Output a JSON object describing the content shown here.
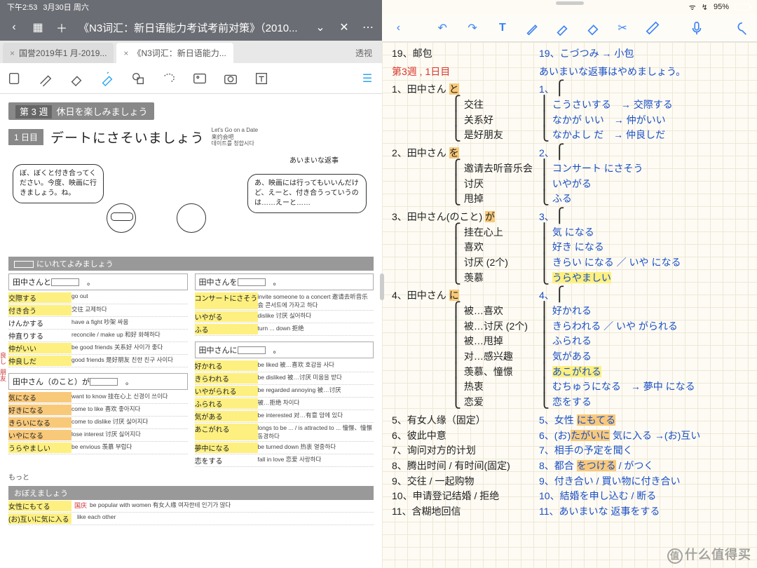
{
  "status": {
    "time": "下午2:53",
    "date": "3月30日 周六",
    "battery": "95%"
  },
  "left": {
    "header": {
      "title": "《N3词汇：新日语能力考试考前对策》（2010..."
    },
    "tabs": {
      "t1": "国誉2019年1 月-2019...",
      "t2": "《N3词汇：新日语能力...",
      "extra": "透视"
    },
    "week": {
      "num": "第 3 週",
      "title": "休日を楽しみましょう"
    },
    "day": {
      "badge": "1 日目",
      "title": "デートにさそいましょう",
      "sub1": "Let's Go on a Date",
      "sub2": "来约会吧",
      "sub3": "데이트를 청합시다"
    },
    "arrow_label": "あいまいな返事",
    "bubble1": "ぼ、ぼくと付き合ってください。今度、映画に行きましょう。ね。",
    "bubble2": "あ、映画には行ってもいいんだけど、えーと、付き合うっていうのは……えーと……",
    "section_reading": "にいれてよみましょう",
    "section_memo": "おぼえましょう",
    "motto": "もっと",
    "col1": {
      "header": "田中さんと",
      "rows": [
        {
          "jp": "交際する",
          "en": "go out",
          "hl": "y"
        },
        {
          "jp": "付き合う",
          "en": "交往  교제하다",
          "hl": "y"
        },
        {
          "jp": "けんかする",
          "en": "have a fight  吵架  싸움"
        },
        {
          "jp": "仲直りする",
          "en": "reconcile / make up\n和好  화해하다"
        },
        {
          "jp": "仲がいい",
          "en": "be good friends\n关系好  사이가 좋다",
          "hl": "y"
        },
        {
          "jp": "仲良しだ",
          "en": "good friends\n是好朋友  친한 친구 사이다",
          "hl": "y"
        }
      ]
    },
    "col2": {
      "header": "田中さんを",
      "rows": [
        {
          "jp": "コンサートにさそう",
          "en": "invite someone to a concert\n邀请去听音乐会\n콘서트에 가자고 하다",
          "hl": "y"
        },
        {
          "jp": "いやがる",
          "en": "dislike  讨厌  싫어하다",
          "hl": "y"
        },
        {
          "jp": "ふる",
          "en": "turn ... down  拒绝",
          "hl": "y"
        }
      ]
    },
    "col3": {
      "header": "田中さん（のこと）が",
      "rows": [
        {
          "jp": "気になる",
          "en": "want to know\n挂在心上  신경이 쓰이다",
          "hl": "o"
        },
        {
          "jp": "好きになる",
          "en": "come to like\n喜欢  좋아지다",
          "hl": "o"
        },
        {
          "jp": "きらいになる",
          "en": "come to dislike\n讨厌  싫어지다",
          "hl": "o"
        },
        {
          "jp": "いやになる",
          "en": "lose interest\n讨厌  싫어지다",
          "hl": "o"
        },
        {
          "jp": "うらやましい",
          "en": "be envious\n羡慕  부럽다",
          "hl": "y"
        }
      ]
    },
    "col4": {
      "header": "田中さんに",
      "rows": [
        {
          "jp": "好かれる",
          "en": "be liked\n被…喜欢  호감을 사다",
          "hl": "y"
        },
        {
          "jp": "きらわれる",
          "en": "be disliked\n被…讨厌  미움을 받다",
          "hl": "y"
        },
        {
          "jp": "いやがられる",
          "en": "be regarded annoying\n被…讨厌",
          "hl": "y"
        },
        {
          "jp": "ふられる",
          "en": "被…拒绝  차이다",
          "hl": "y"
        },
        {
          "jp": "気がある",
          "en": "be interested\n对…有意  맘에 있다",
          "hl": "y"
        },
        {
          "jp": "あこがれる",
          "en": "longs to be ... / is attracted to ...\n憧憬、憧憬  동경하다",
          "hl": "y"
        },
        {
          "jp": "夢中になる",
          "en": "be turned down\n热衷  열중하다",
          "hl": "y"
        },
        {
          "jp": "恋をする",
          "en": "fall in love\n恋爱  사랑하다"
        }
      ]
    },
    "memo_rows": [
      {
        "jp": "女性にもてる",
        "ann": "国庆",
        "en": "be popular with women\n有女人缘  여자한테 인기가 많다",
        "hl": "y"
      },
      {
        "jp": "(お)互いに気に入る",
        "en": "like each other",
        "hl": "y"
      }
    ],
    "red_ann1": "良し",
    "red_ann2": "朋友"
  },
  "right": {
    "line0": {
      "l": "19、邮包",
      "r": "19、こづつみ  → 小包"
    },
    "title": {
      "l": "第3週 , 1日目",
      "r": "あいまいな返事はやめましょう。"
    },
    "g1": {
      "head_l": "1、田中さん と",
      "head_r": "1、",
      "items": [
        {
          "l": "交往",
          "r": "こうさいする　→ 交際する"
        },
        {
          "l": "关系好",
          "r": "なかが いい　→ 仲がいい"
        },
        {
          "l": "是好朋友",
          "r": "なかよし だ　→ 仲良しだ"
        }
      ]
    },
    "g2": {
      "head_l": "2、田中さん を",
      "head_r": "2、",
      "items": [
        {
          "l": "邀请去听音乐会",
          "r": "コンサート にさそう"
        },
        {
          "l": "讨厌",
          "r": "いやがる"
        },
        {
          "l": "甩掉",
          "r": "ふる"
        }
      ]
    },
    "g3": {
      "head_l": "3、田中さん(のこと) が",
      "head_r": "3、",
      "items": [
        {
          "l": "挂在心上",
          "r": "気 になる"
        },
        {
          "l": "喜欢",
          "r": "好き になる"
        },
        {
          "l": "讨厌 (2个)",
          "r": "きらい になる ／ いや になる"
        },
        {
          "l": "羡慕",
          "r": "うらやましい",
          "hl": "y"
        }
      ]
    },
    "g4": {
      "head_l": "4、田中さん に",
      "head_r": "4、",
      "items": [
        {
          "l": "被…喜欢",
          "r": "好かれる"
        },
        {
          "l": "被…讨厌 (2个)",
          "r": "きらわれる ／ いや がられる"
        },
        {
          "l": "被…甩掉",
          "r": "ふられる"
        },
        {
          "l": "对…感兴趣",
          "r": "気がある"
        },
        {
          "l": "羡慕、憧憬",
          "r": "あこがれる",
          "hl": "y"
        },
        {
          "l": "热衷",
          "r": "むちゅうになる　→ 夢中 になる"
        },
        {
          "l": "恋爱",
          "r": "恋をする"
        }
      ]
    },
    "list": [
      {
        "n": "5",
        "l": "有女人缘（固定）",
        "r": "5、女性 にもてる",
        "hl": "o"
      },
      {
        "n": "6",
        "l": "彼此中意",
        "r": "6、(お)たがいに 気に入る →(お)互い",
        "hl": "o"
      },
      {
        "n": "7",
        "l": "询问对方的计划",
        "r": "7、相手の予定を聞く"
      },
      {
        "n": "8",
        "l": "腾出时间 / 有时间(固定)",
        "r": "8、都合 をつける / がつく",
        "hl": "o"
      },
      {
        "n": "9",
        "l": "交往 / 一起购物",
        "r": "9、付き合い / 買い物に付き合い"
      },
      {
        "n": "10",
        "l": "申请登记结婚 / 拒绝",
        "r": "10、結婚を申し込む / 断る"
      },
      {
        "n": "11",
        "l": "含糊地回信",
        "r": "11、あいまいな 返事をする"
      }
    ]
  },
  "watermark": "什么值得买"
}
